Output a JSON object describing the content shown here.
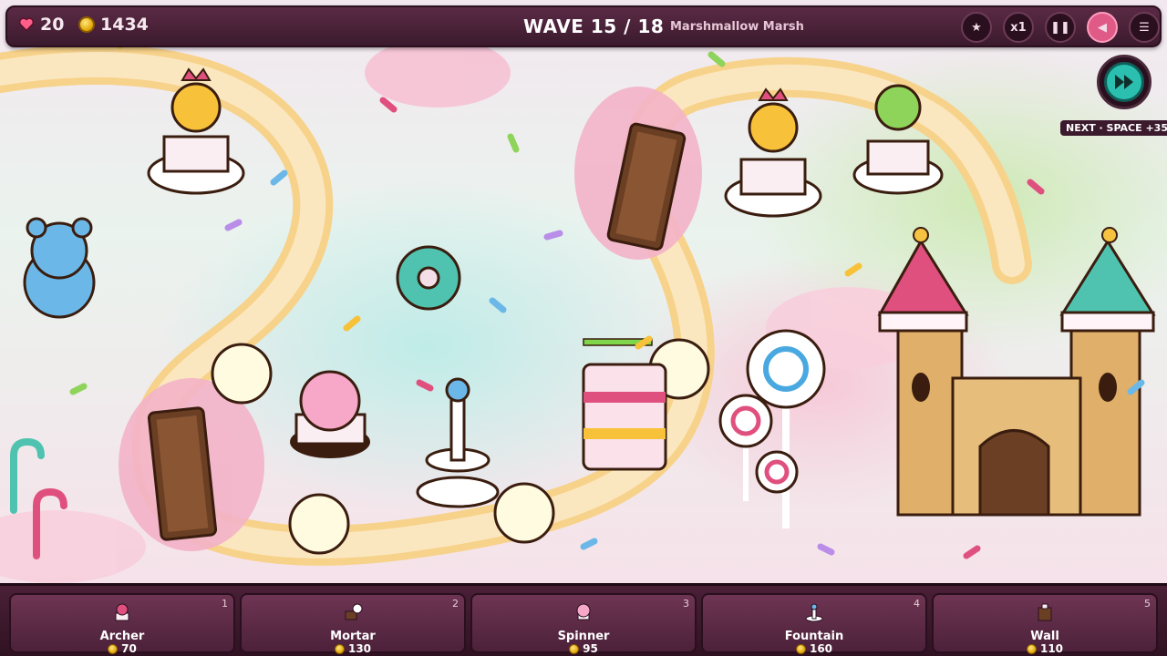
{
  "hud": {
    "lives": "20",
    "gold": "1434",
    "wave": "WAVE 15 / 18",
    "level_name": "Marshmallow Marsh",
    "speed_label": "x1",
    "next_hint": "NEXT · SPACE +35"
  },
  "towers": [
    {
      "name": "Archer",
      "cost": "70",
      "key": "1"
    },
    {
      "name": "Mortar",
      "cost": "130",
      "key": "2"
    },
    {
      "name": "Spinner",
      "cost": "95",
      "key": "3"
    },
    {
      "name": "Fountain",
      "cost": "160",
      "key": "4"
    },
    {
      "name": "Wall",
      "cost": "110",
      "key": "5"
    }
  ],
  "colors": {
    "path": "#f7d28a",
    "bar": "#3b1a2d",
    "accent_teal": "#2bbfb0",
    "accent_pink": "#e05a88"
  }
}
